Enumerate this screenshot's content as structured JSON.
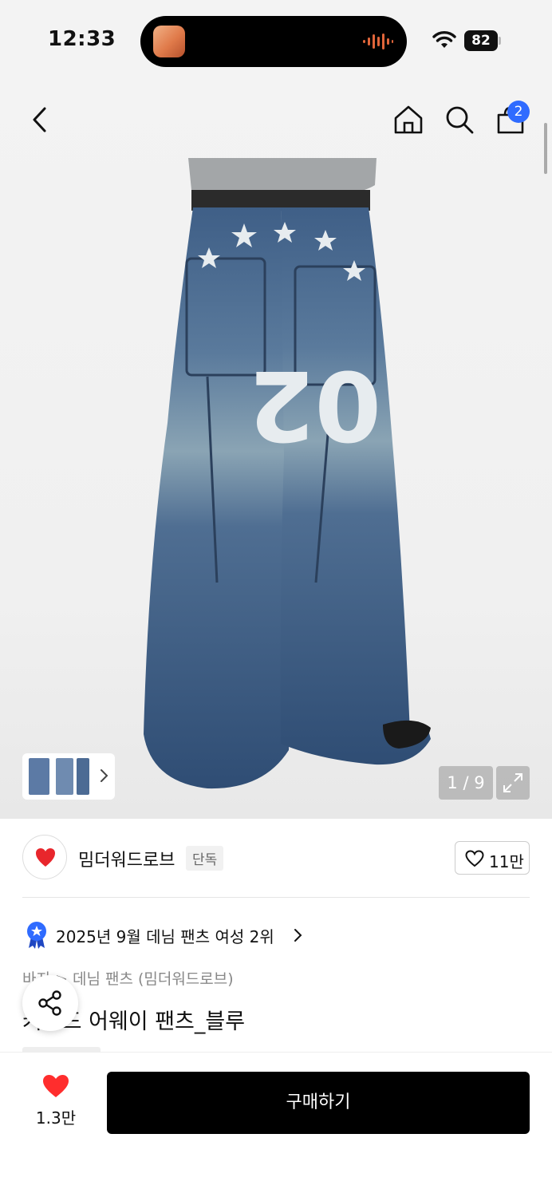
{
  "status_bar": {
    "time": "12:33",
    "battery": "82",
    "icons": [
      "app-icon",
      "audio-wave-icon",
      "wifi-icon",
      "battery-icon"
    ]
  },
  "nav": {
    "icons": [
      "back-icon",
      "home-icon",
      "search-icon",
      "cart-icon"
    ],
    "cart_count": "2"
  },
  "gallery": {
    "counter": "1 / 9",
    "icons": [
      "expand-icon",
      "chevron-right-icon"
    ]
  },
  "brand": {
    "name": "밈더워드로브",
    "tag": "단독",
    "likes": "11만"
  },
  "ranking": {
    "text": "2025년 9월 데님 팬츠 여성 2위",
    "accent": "#2f6bff"
  },
  "product": {
    "breadcrumb": "바지 > 데님 팬츠 (밈더워드로브)",
    "title": "커브드 어웨이 팬츠_블루"
  },
  "bottom": {
    "wish_count": "1.3만",
    "buy_label": "구매하기",
    "heart_color": "#ff2d2d"
  }
}
